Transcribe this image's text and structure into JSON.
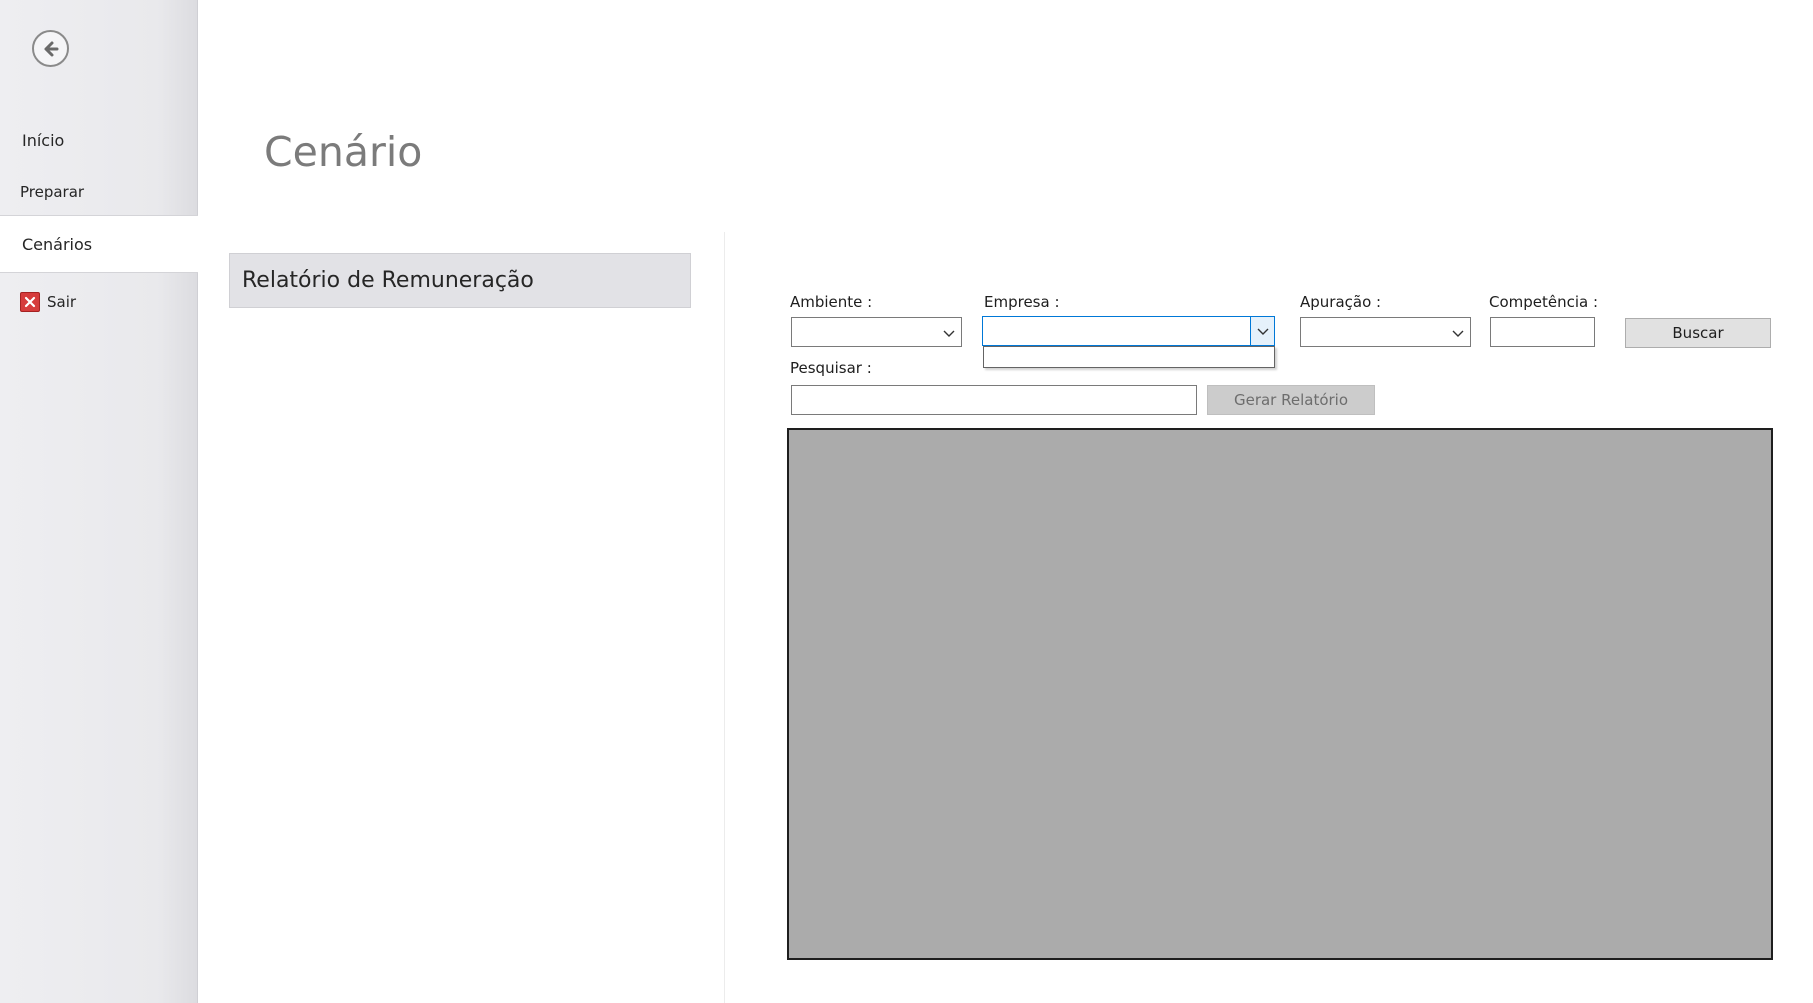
{
  "sidebar": {
    "back_icon": "back-arrow-icon",
    "items": [
      {
        "label": "Início"
      },
      {
        "label": "Preparar"
      },
      {
        "label": "Cenários"
      },
      {
        "label": "Sair",
        "icon": "exit-x-icon"
      }
    ],
    "exit_color": "#d63b3b"
  },
  "page": {
    "title": "Cenário"
  },
  "scenarios": [
    {
      "label": "Relatório de Remuneração"
    }
  ],
  "form": {
    "ambiente_label": "Ambiente :",
    "empresa_label": "Empresa :",
    "apuracao_label": "Apuração :",
    "competencia_label": "Competência :",
    "pesquisar_label": "Pesquisar :",
    "ambiente_value": "",
    "empresa_value": "",
    "apuracao_value": "",
    "competencia_value": "",
    "pesquisar_value": "",
    "buscar_label": "Buscar",
    "gerar_label": "Gerar Relatório"
  },
  "colors": {
    "focus": "#0078d7",
    "grid_bg": "#ababab"
  }
}
